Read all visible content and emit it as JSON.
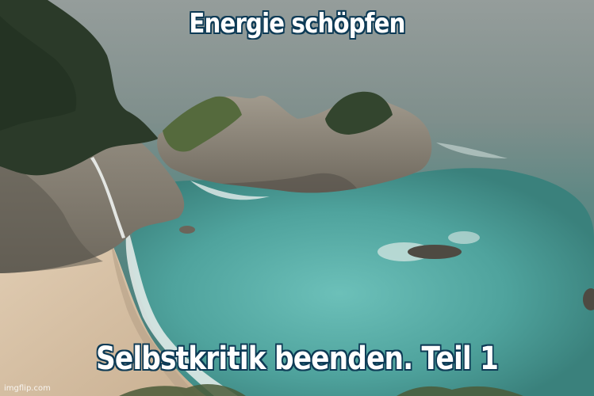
{
  "meme": {
    "top_text": "Energie schöpfen",
    "bottom_text": "Selbstkritik beenden. Teil 1",
    "watermark": "imgflip.com"
  },
  "colors": {
    "sea": "#3f8a86",
    "lagoon": "#5fb0aa",
    "sky_haze": "#8d9694",
    "sand": "#d8c2a6",
    "rock": "#8b8376",
    "forest": "#2f3b2c",
    "text_fill": "#ffffff",
    "text_outline": "#0d3a55"
  }
}
